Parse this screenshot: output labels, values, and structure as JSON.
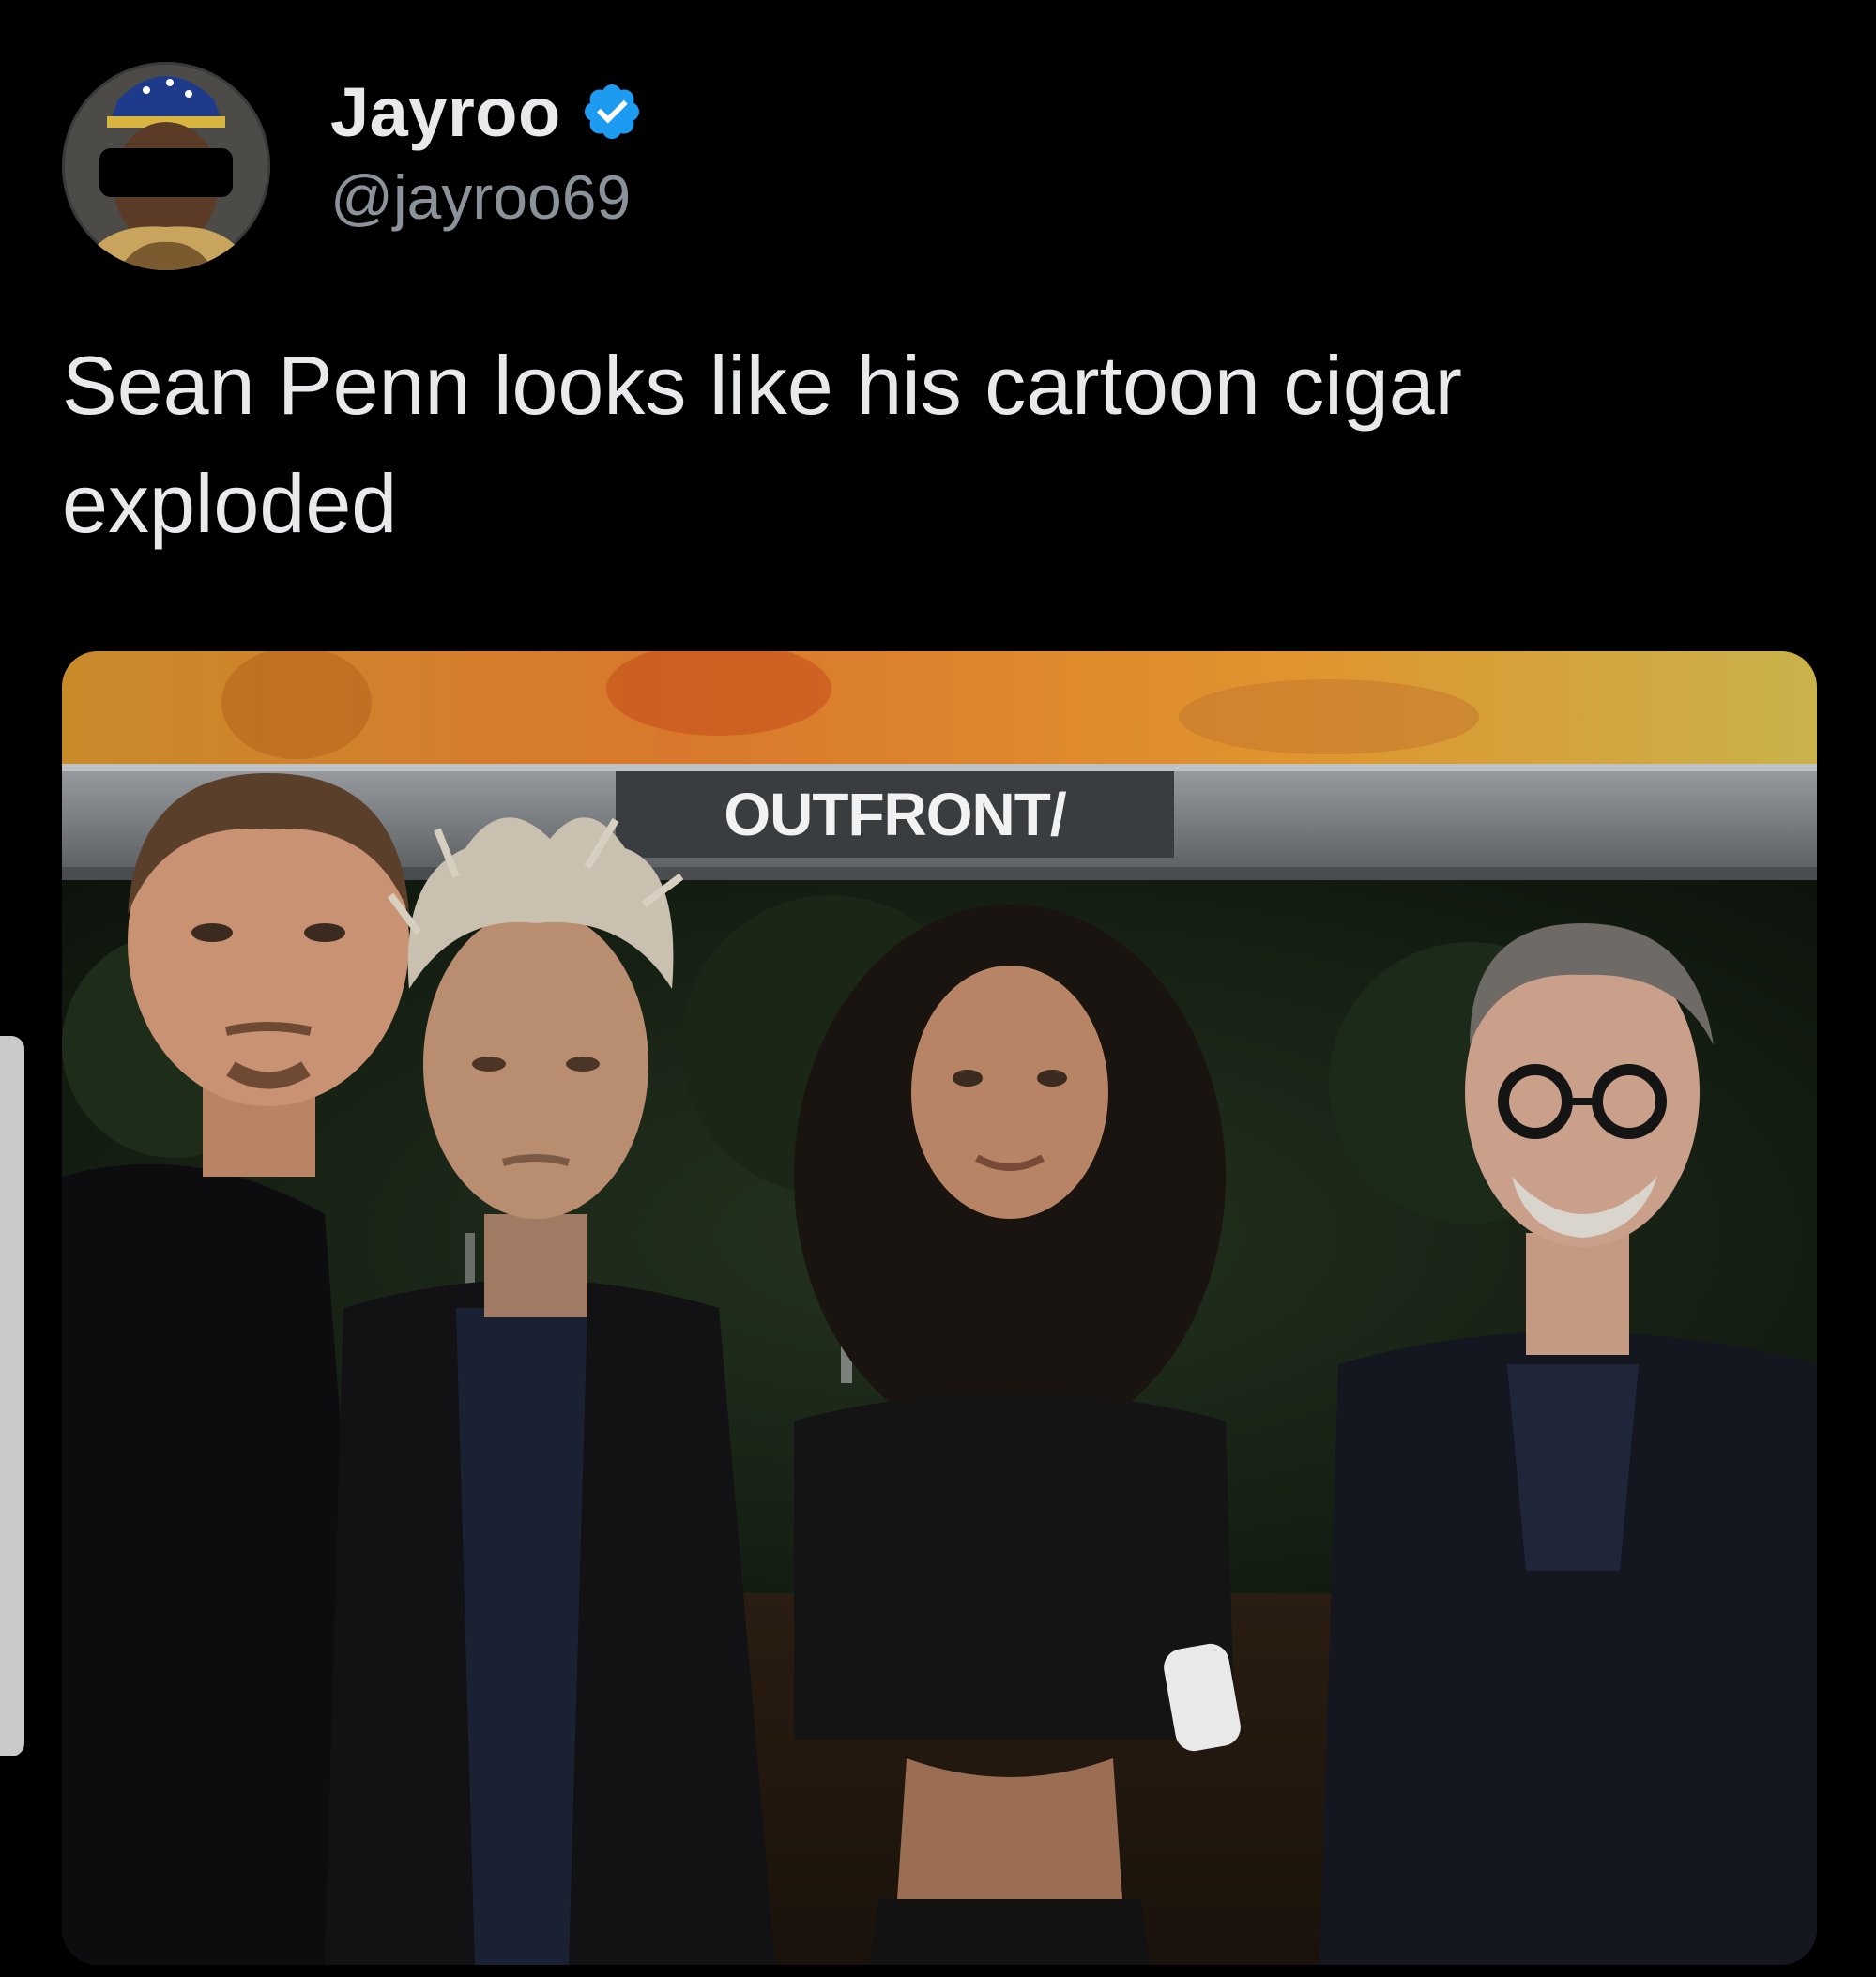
{
  "tweet": {
    "author": {
      "display_name": "Jayroo",
      "handle": "@jayroo69",
      "verified": true,
      "avatar_icon": "user-avatar"
    },
    "text": "Sean Penn looks like his cartoon cigar exploded",
    "media": {
      "sign_text": "OUTFRONT/"
    }
  },
  "colors": {
    "background": "#000000",
    "text": "#e7e9ea",
    "secondary_text": "#8b9299",
    "verified_badge": "#1d9bf0"
  }
}
